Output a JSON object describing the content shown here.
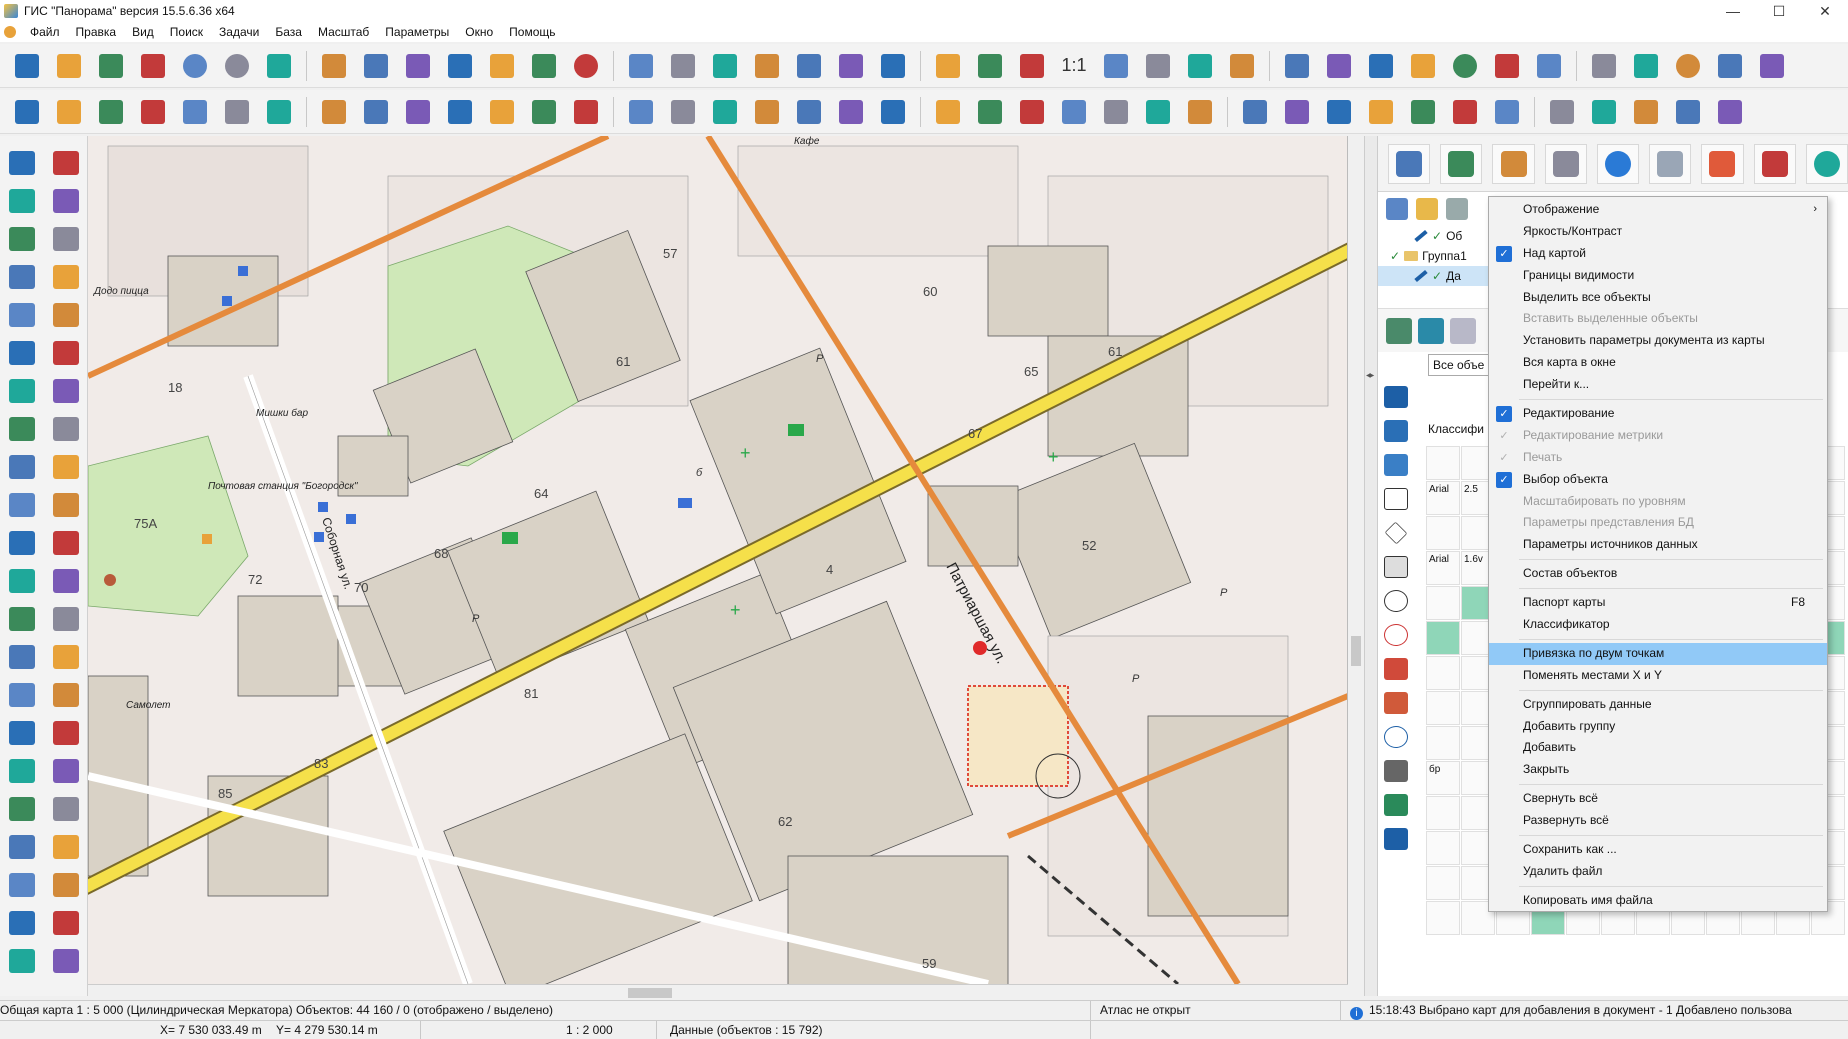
{
  "window": {
    "title": "ГИС \"Панорама\" версия 15.5.6.36 x64",
    "controls": [
      "—",
      "☐",
      "✕"
    ]
  },
  "menu": [
    "Файл",
    "Правка",
    "Вид",
    "Поиск",
    "Задачи",
    "База",
    "Масштаб",
    "Параметры",
    "Окно",
    "Помощь"
  ],
  "toolbar": {
    "scale_button": "1:1"
  },
  "map": {
    "street_labels": {
      "patriarshaya": "Патриаршая ул.",
      "sobornaya": "Соборная ул."
    },
    "place_labels": {
      "dodo": "Додо пицца",
      "mishki": "Мишки бар",
      "post_office": "Почтовая станция \"Богородск\"",
      "samolet": "Самолет",
      "cafe": "Кафе"
    },
    "building_numbers": [
      "57",
      "60",
      "61",
      "65",
      "81",
      "68",
      "70",
      "72",
      "75А",
      "18",
      "83",
      "85",
      "62",
      "67",
      "52",
      "59",
      "4",
      "64",
      "61"
    ],
    "map_letters": [
      "Р",
      "Р",
      "Р",
      "Р",
      "б"
    ]
  },
  "right_panel": {
    "tree": {
      "row1": "Об",
      "group": "Группа1",
      "row3": "Да"
    },
    "filter_select": "Все объе",
    "classifier_label": "Классифи",
    "sym_labels": [
      "Arial",
      "2.5",
      "Arial",
      "1.6v",
      "бр"
    ]
  },
  "context_menu": {
    "items": [
      {
        "label": "Отображение",
        "submenu": true
      },
      {
        "label": "Яркость/Контраст"
      },
      {
        "label": "Над картой",
        "checked": true
      },
      {
        "label": "Границы видимости"
      },
      {
        "label": "Выделить все объекты"
      },
      {
        "label": "Вставить выделенные объекты",
        "disabled": true
      },
      {
        "label": "Установить параметры документа из карты"
      },
      {
        "label": "Вся карта в окне"
      },
      {
        "label": "Перейти к..."
      },
      {
        "sep": true
      },
      {
        "label": "Редактирование",
        "checked": true
      },
      {
        "label": "Редактирование метрики",
        "checked": true,
        "disabled": true
      },
      {
        "label": "Печать",
        "checked": true,
        "disabled": true
      },
      {
        "label": "Выбор объекта",
        "checked": true
      },
      {
        "label": "Масштабировать по уровням",
        "disabled": true
      },
      {
        "label": "Параметры представления БД",
        "disabled": true
      },
      {
        "label": "Параметры источников данных"
      },
      {
        "sep": true
      },
      {
        "label": "Состав объектов"
      },
      {
        "sep": true
      },
      {
        "label": "Паспорт карты",
        "shortcut": "F8"
      },
      {
        "label": "Классификатор"
      },
      {
        "sep": true
      },
      {
        "label": "Привязка по двум точкам",
        "highlighted": true
      },
      {
        "label": "Поменять местами X и Y"
      },
      {
        "sep": true
      },
      {
        "label": "Сгруппировать данные"
      },
      {
        "label": "Добавить группу"
      },
      {
        "label": "Добавить"
      },
      {
        "label": "Закрыть"
      },
      {
        "sep": true
      },
      {
        "label": "Свернуть всё"
      },
      {
        "label": "Развернуть всё"
      },
      {
        "sep": true
      },
      {
        "label": "Сохранить как ..."
      },
      {
        "label": "Удалить файл"
      },
      {
        "sep": true
      },
      {
        "label": "Копировать имя файла"
      }
    ]
  },
  "status": {
    "map_info": "Общая карта  1 : 5 000 (Цилиндрическая Меркатора) Объектов: 44 160 / 0 (отображено / выделено)",
    "atlas": "Атлас не открыт",
    "message": "15:18:43  Выбрано карт для добавления в документ - 1  Добавлено пользова",
    "x_coord": "X= 7 530 033.49 m",
    "y_coord": "Y= 4 279 530.14 m",
    "scale": "1 : 2 000",
    "data_info": "Данные   (объектов : 15 792)"
  },
  "colors": {
    "road_yellow": "#f5e04a",
    "road_orange": "#e58a3c",
    "park_green": "#cfe8b8",
    "building_tan": "#d9d2c6",
    "highlight_blue": "#91c9f7",
    "accent_blue": "#1f6fd6"
  },
  "icons": {
    "toolbar1": [
      "new-doc-icon",
      "open-folder-icon",
      "open-map-icon",
      "dbm-icon",
      "globe-icon",
      "doc-globe-icon",
      "layers-icon",
      "tree-icon",
      "binoculars-icon",
      "binoculars-a-icon",
      "binoculars-dots-icon",
      "binoculars-gray-icon",
      "binoculars-house-icon",
      "binoculars-globe-icon",
      "list-icon",
      "eraser-icon",
      "select-edit-icon",
      "add-object-icon",
      "check-object-icon",
      "delete-object-icon",
      "palette-icon",
      "lightning-icon",
      "zoom-out-icon",
      "zoom-in-icon",
      "full-extent-icon",
      "frame-icon",
      "check-frame-icon",
      "arrow-back-icon",
      "screen-icon",
      "screen2-icon",
      "calendar-icon",
      "image-icon",
      "globe-pin-icon",
      "pin-icon",
      "pointer-icon",
      "printer-icon",
      "printer2-icon",
      "color-wheel-icon",
      "help-pointer-icon",
      "close-red-icon",
      "pen-green-icon"
    ],
    "toolbar2": [
      "pencil-icon",
      "pencil-dots-icon",
      "pencil-line-icon",
      "stack-green-icon",
      "stack-dots-icon",
      "stack-blue-icon",
      "arrows-icon",
      "cross-arrows-icon",
      "diamond-icon",
      "ruler-icon",
      "abc-strike-icon",
      "abc-green-icon",
      "abc-arrow-icon",
      "copy-icon",
      "edit-lines-icon",
      "pen-curve-icon",
      "pen-wave-icon",
      "point-edit-icon",
      "scissors-icon",
      "scissors2-icon",
      "scissors-blue-icon",
      "scissors3-icon",
      "split-icon",
      "split2-icon",
      "blocks-icon",
      "blocks2-icon",
      "blocks3-icon",
      "grid-icon",
      "grid-red-icon",
      "axis-icon",
      "cross-icon",
      "cross2-icon",
      "cross3-icon",
      "cross4-icon",
      "bracket-icon",
      "bracket2-icon",
      "bracket3-icon",
      "bracket4-icon",
      "align-icon",
      "axis-green-icon"
    ]
  }
}
